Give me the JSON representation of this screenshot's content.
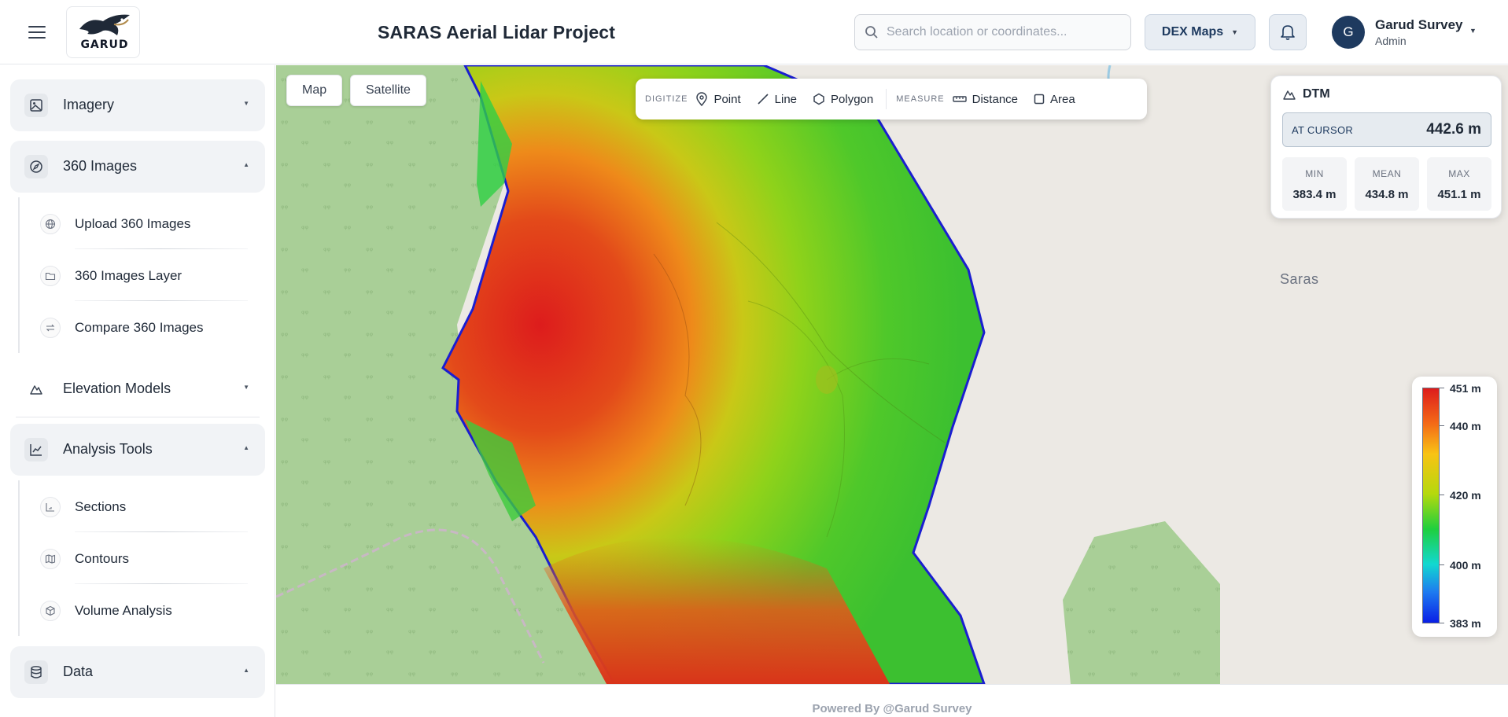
{
  "header": {
    "logo_text": "GARUD",
    "project_title": "SARAS Aerial Lidar Project",
    "search_placeholder": "Search location or coordinates...",
    "basemap_button": "DEX Maps",
    "user_initial": "G",
    "user_name": "Garud Survey",
    "user_role": "Admin"
  },
  "sidebar": {
    "sections": [
      {
        "label": "Imagery",
        "icon": "image-icon",
        "expanded": false
      },
      {
        "label": "360 Images",
        "icon": "compass-icon",
        "expanded": true,
        "items": [
          {
            "label": "Upload 360 Images",
            "icon": "globe-icon"
          },
          {
            "label": "360 Images Layer",
            "icon": "folder-icon"
          },
          {
            "label": "Compare 360 Images",
            "icon": "swap-icon"
          }
        ]
      },
      {
        "label": "Elevation Models",
        "icon": "mountain-icon",
        "expanded": false
      },
      {
        "label": "Analysis Tools",
        "icon": "line-chart-icon",
        "expanded": true,
        "items": [
          {
            "label": "Sections",
            "icon": "section-icon"
          },
          {
            "label": "Contours",
            "icon": "map-icon"
          },
          {
            "label": "Volume Analysis",
            "icon": "cube-icon"
          }
        ]
      },
      {
        "label": "Data",
        "icon": "database-icon",
        "expanded": true
      }
    ]
  },
  "map": {
    "view_toggle": [
      "Map",
      "Satellite"
    ],
    "place_label": "Saras",
    "toolbar": {
      "digitize_label": "DIGITIZE",
      "digitize_tools": [
        "Point",
        "Line",
        "Polygon"
      ],
      "measure_label": "MEASURE",
      "measure_tools": [
        "Distance",
        "Area"
      ]
    },
    "dtm_panel": {
      "title": "DTM",
      "cursor_label": "AT CURSOR",
      "cursor_value": "442.6 m",
      "stats": [
        {
          "label": "MIN",
          "value": "383.4 m"
        },
        {
          "label": "MEAN",
          "value": "434.8 m"
        },
        {
          "label": "MAX",
          "value": "451.1 m"
        }
      ]
    },
    "legend": {
      "labels": [
        "451 m",
        "440 m",
        "420 m",
        "400 m",
        "383 m"
      ]
    }
  },
  "footer": {
    "text": "Powered By @Garud Survey"
  },
  "colors": {
    "accent": "#1e3a5f",
    "forest": "#a9cf97",
    "map_bg": "#ece9e4",
    "dem_high": "#dd1c1c",
    "dem_low": "#0a1fe6"
  }
}
